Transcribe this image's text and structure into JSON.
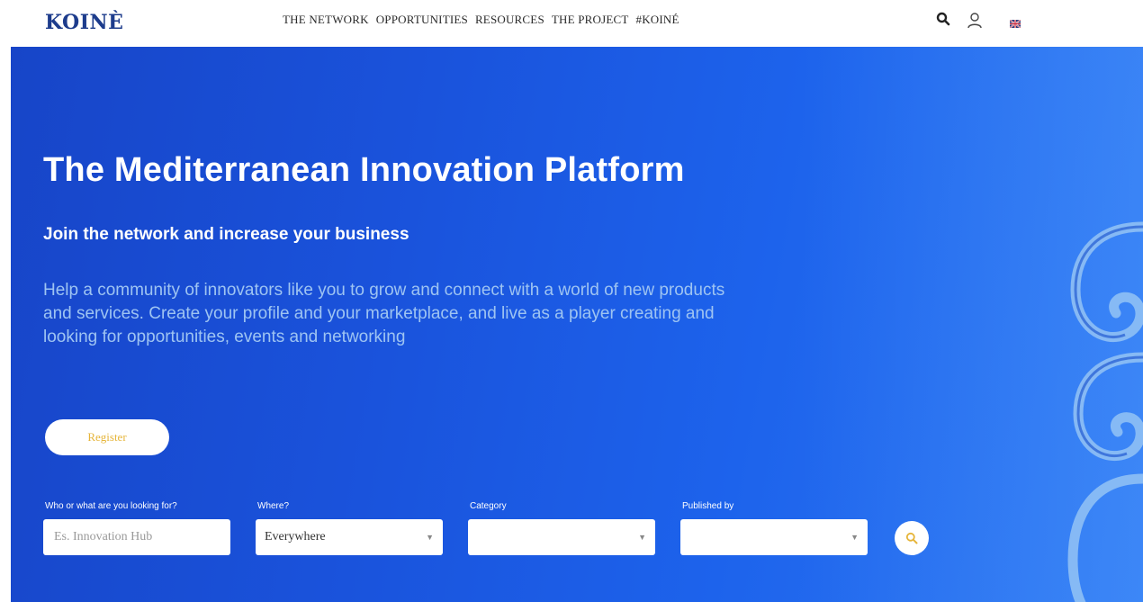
{
  "header": {
    "logo": "KOINÈ",
    "nav": [
      "THE NETWORK",
      "OPPORTUNITIES",
      "RESOURCES",
      "THE PROJECT",
      "#KOINÉ"
    ],
    "icons": [
      "search-icon",
      "user-icon",
      "flag-uk-icon"
    ]
  },
  "hero": {
    "title": "The Mediterranean Innovation Platform",
    "subtitle": "Join the network and increase your business",
    "description": "Help a community of innovators like you to grow and connect with a world of new products and services. Create your profile and your marketplace, and live as a player creating and looking for opportunities, events and networking",
    "register_label": "Register"
  },
  "search": {
    "who_label": "Who or what are you looking for?",
    "who_placeholder": "Es. Innovation Hub",
    "where_label": "Where?",
    "where_value": "Everywhere",
    "category_label": "Category",
    "category_value": "",
    "published_label": "Published by",
    "published_value": ""
  },
  "colors": {
    "brand": "#1d3c8c",
    "hero_blue": "#1a53dc",
    "accent_yellow": "#e6b53a"
  }
}
